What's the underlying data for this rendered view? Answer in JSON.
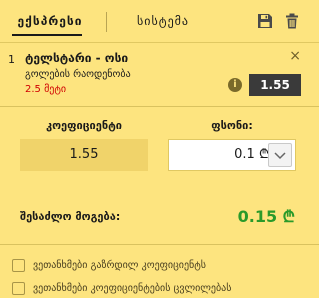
{
  "tabs": {
    "express_label": "ექსპრესი",
    "system_label": "სისტემა"
  },
  "header_icons": [
    "save-icon",
    "trash-icon"
  ],
  "bet": {
    "number": "1",
    "match": "ტელსტარი - ოსი",
    "market": "გოლების რაოდენობა",
    "selection": "2.5 მეტი",
    "odds": "1.55",
    "close_symbol": "×",
    "info_symbol": "i"
  },
  "stake": {
    "coef_label": "კოეფიციენტი",
    "amount_label": "ფსონი:",
    "coef_value": "1.55",
    "amount_value": "0.1 ₾"
  },
  "win": {
    "label": "შესაძლო მოგება:",
    "value": "0.15 ₾"
  },
  "options": [
    {
      "label": "ვეთანხმები გაზრდილ კოეფიციენტს",
      "checked": false
    },
    {
      "label": "ვეთანხმები კოეფიციენტების ცვლილებას",
      "checked": false
    }
  ],
  "colors": {
    "panel_bg": "#fde47f",
    "odds_badge": "#3a3a3a",
    "selection_red": "#d00000",
    "win_green": "#2a9a2a"
  }
}
